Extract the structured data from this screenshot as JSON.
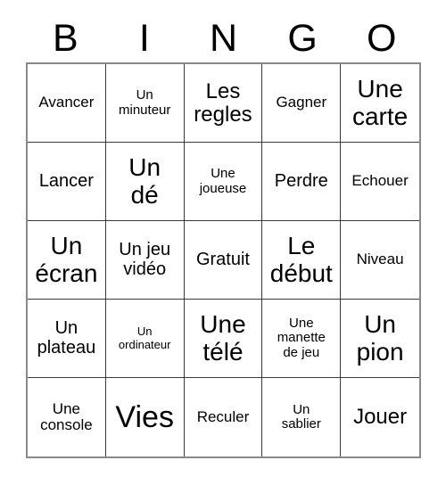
{
  "card": {
    "title": "BINGO",
    "header_letters": [
      "B",
      "I",
      "N",
      "G",
      "O"
    ],
    "grid_size": "5x5",
    "colors": {
      "background": "#ffffff",
      "text": "#000000",
      "cell_border": "#3a3a3a",
      "outer_border": "#8a8a8a"
    },
    "rows": [
      [
        {
          "text": "Avancer",
          "size": "fs-m"
        },
        {
          "text": "Un\nminuteur",
          "size": "fs-s"
        },
        {
          "text": "Les\nregles",
          "size": "fs-xl"
        },
        {
          "text": "Gagner",
          "size": "fs-m"
        },
        {
          "text": "Une\ncarte",
          "size": "fs-xxl"
        }
      ],
      [
        {
          "text": "Lancer",
          "size": "fs-l"
        },
        {
          "text": "Un\ndé",
          "size": "fs-xxl"
        },
        {
          "text": "Une\njoueuse",
          "size": "fs-s"
        },
        {
          "text": "Perdre",
          "size": "fs-l"
        },
        {
          "text": "Echouer",
          "size": "fs-m"
        }
      ],
      [
        {
          "text": "Un\nécran",
          "size": "fs-xxl"
        },
        {
          "text": "Un jeu\nvidéo",
          "size": "fs-l"
        },
        {
          "text": "Gratuit",
          "size": "fs-l"
        },
        {
          "text": "Le\ndébut",
          "size": "fs-xxl"
        },
        {
          "text": "Niveau",
          "size": "fs-m"
        }
      ],
      [
        {
          "text": "Un\nplateau",
          "size": "fs-l"
        },
        {
          "text": "Un\nordinateur",
          "size": "fs-xs"
        },
        {
          "text": "Une\ntélé",
          "size": "fs-xxl"
        },
        {
          "text": "Une\nmanette\nde jeu",
          "size": "fs-s"
        },
        {
          "text": "Un\npion",
          "size": "fs-xxl"
        }
      ],
      [
        {
          "text": "Une\nconsole",
          "size": "fs-m"
        },
        {
          "text": "Vies",
          "size": "fs-huge"
        },
        {
          "text": "Reculer",
          "size": "fs-m"
        },
        {
          "text": "Un\nsablier",
          "size": "fs-s"
        },
        {
          "text": "Jouer",
          "size": "fs-xl"
        }
      ]
    ]
  }
}
